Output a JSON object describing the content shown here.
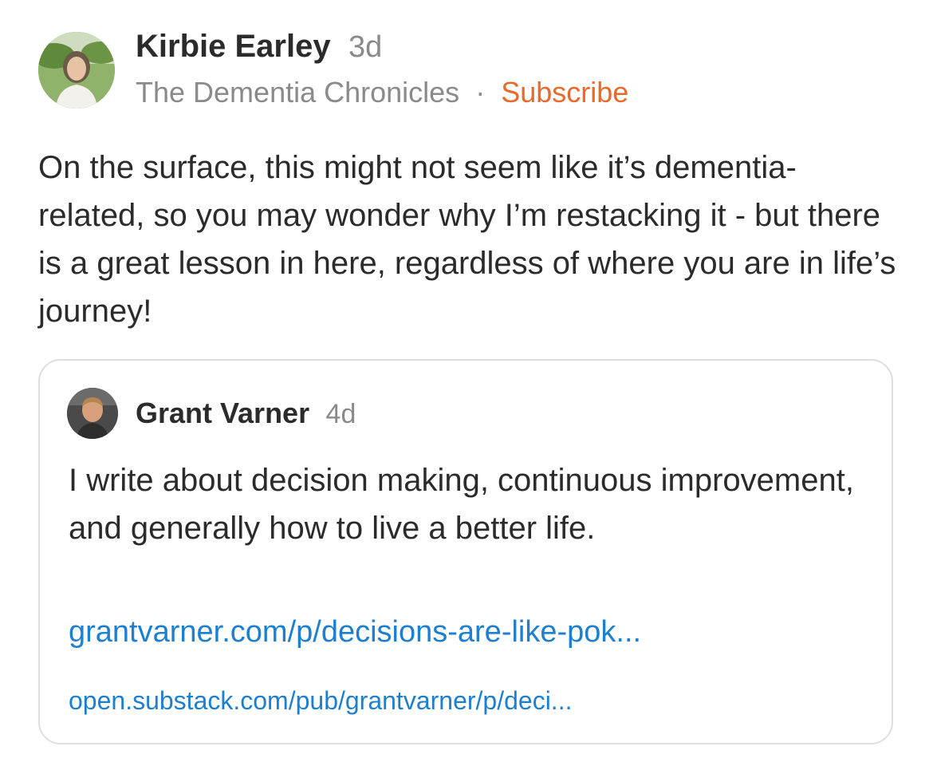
{
  "post": {
    "author": {
      "name": "Kirbie Earley",
      "age": "3d",
      "avatar_icon": "avatar-photo-woman"
    },
    "publication": {
      "name": "The Dementia Chronicles",
      "separator": "·",
      "subscribe_label": "Subscribe",
      "subscribe_color": "#e8692c"
    },
    "body": "On the surface, this might not seem like it’s dementia-related, so you may wonder why I’m restacking it - but there is a great lesson in here, regardless of where you are in life’s journey!"
  },
  "quoted": {
    "author": {
      "name": "Grant Varner",
      "age": "4d",
      "avatar_icon": "avatar-photo-man"
    },
    "body": "I write about decision making, continuous improvement, and generally how to live a better life.",
    "link_primary": "grantvarner.com/p/decisions-are-like-pok...",
    "link_secondary": "open.substack.com/pub/grantvarner/p/deci...",
    "link_color": "#1c7fd0"
  }
}
